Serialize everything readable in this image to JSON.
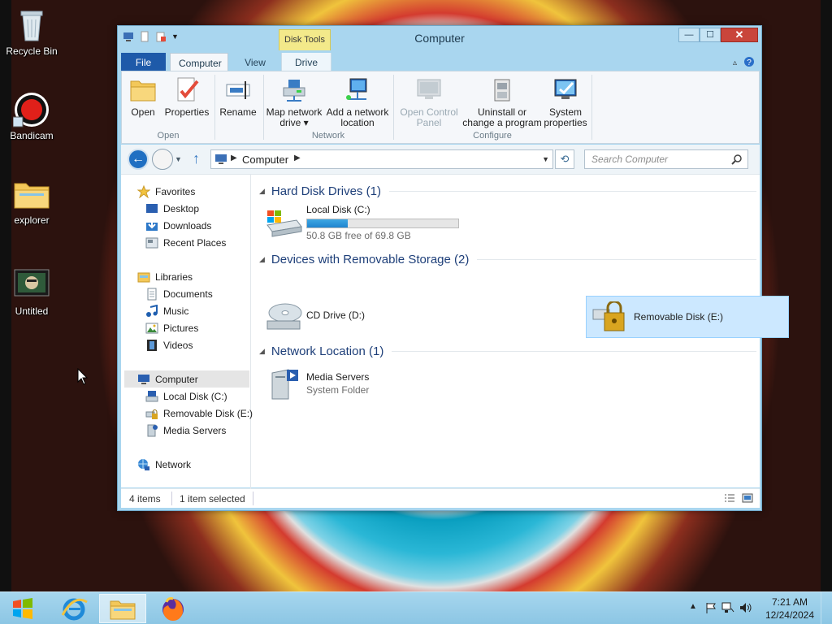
{
  "desktop": {
    "icons": [
      {
        "label": "Recycle Bin",
        "icon": "recycle-bin-icon"
      },
      {
        "label": "Bandicam",
        "icon": "bandicam-icon"
      },
      {
        "label": "explorer",
        "icon": "folder-icon"
      },
      {
        "label": "Untitled",
        "icon": "video-thumbnail-icon"
      }
    ]
  },
  "window": {
    "title": "Computer",
    "contextual_tab": "Disk Tools",
    "buttons": {
      "minimize": "—",
      "maximize": "☐",
      "close": "✕"
    }
  },
  "ribbon": {
    "tabs": {
      "file": "File",
      "computer": "Computer",
      "view": "View",
      "drive": "Drive"
    },
    "groups": {
      "open": "Open",
      "network": "Network",
      "configure": "Configure"
    },
    "buttons": {
      "open": "Open",
      "properties": "Properties",
      "rename": "Rename",
      "map_network_drive_1": "Map network",
      "map_network_drive_2": "drive ▾",
      "add_network_location_1": "Add a network",
      "add_network_location_2": "location",
      "open_control_panel_1": "Open Control",
      "open_control_panel_2": "Panel",
      "uninstall_1": "Uninstall or",
      "uninstall_2": "change a program",
      "system_properties_1": "System",
      "system_properties_2": "properties"
    }
  },
  "address": {
    "path": "Computer",
    "search_placeholder": "Search Computer"
  },
  "navpane": {
    "favorites": "Favorites",
    "desktop": "Desktop",
    "downloads": "Downloads",
    "recent_places": "Recent Places",
    "libraries": "Libraries",
    "documents": "Documents",
    "music": "Music",
    "pictures": "Pictures",
    "videos": "Videos",
    "computer": "Computer",
    "local_disk": "Local Disk (C:)",
    "removable_disk": "Removable Disk (E:)",
    "media_servers": "Media Servers",
    "network": "Network"
  },
  "content": {
    "sections": {
      "hdd": "Hard Disk Drives (1)",
      "removable": "Devices with Removable Storage (2)",
      "network": "Network Location (1)"
    },
    "local_disk": {
      "name": "Local Disk (C:)",
      "free_text": "50.8 GB free of 69.8 GB",
      "used_fraction": 0.27
    },
    "cd_drive": {
      "name": "CD Drive (D:)"
    },
    "removable_disk": {
      "name": "Removable Disk (E:)"
    },
    "media_servers": {
      "name": "Media Servers",
      "type": "System Folder"
    }
  },
  "status": {
    "items": "4 items",
    "selected": "1 item selected"
  },
  "taskbar": {
    "time": "7:21 AM",
    "date": "12/24/2024"
  },
  "colors": {
    "accent": "#1e5aa9",
    "title_bar": "#a9d6ef",
    "selection": "#cce8ff",
    "close_button": "#c9453b"
  }
}
